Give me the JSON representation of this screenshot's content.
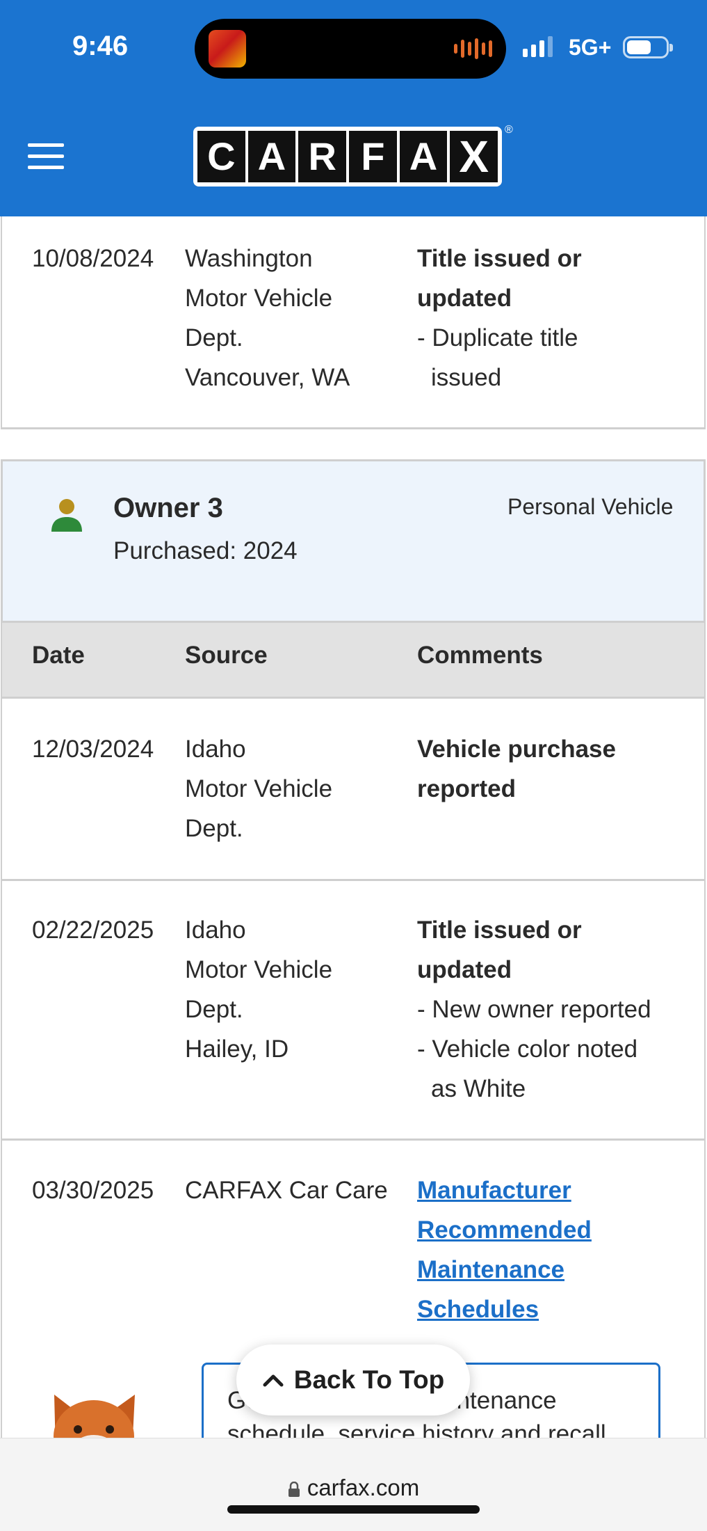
{
  "status_bar": {
    "time": "9:46",
    "network": "5G+",
    "battery_level": 0.6
  },
  "header": {
    "logo_letters": [
      "C",
      "A",
      "R",
      "F",
      "A",
      "X"
    ],
    "logo_registered": "®",
    "brand_color": "#1b74d0"
  },
  "previous_record": {
    "date": "10/08/2024",
    "source_lines": [
      "Washington",
      "Motor Vehicle",
      "Dept.",
      "Vancouver, WA"
    ],
    "comment_title": "Title issued or updated",
    "comment_items": [
      "- Duplicate title issued"
    ]
  },
  "owner": {
    "title": "Owner 3",
    "purchased": "Purchased: 2024",
    "type": "Personal Vehicle"
  },
  "table": {
    "headers": [
      "Date",
      "Source",
      "Comments"
    ],
    "rows": [
      {
        "date": "12/03/2024",
        "source_lines": [
          "Idaho",
          "Motor Vehicle",
          "Dept."
        ],
        "comment_title": "Vehicle purchase reported"
      },
      {
        "date": "02/22/2025",
        "source_lines": [
          "Idaho",
          "Motor Vehicle",
          "Dept.",
          "Hailey, ID"
        ],
        "comment_title": "Title issued or updated",
        "comment_items": [
          "- New owner reported",
          "- Vehicle color noted as White"
        ]
      },
      {
        "date": "03/30/2025",
        "source": "CARFAX Car Care",
        "comment_link": "Manufacturer Recommended Maintenance Schedules"
      }
    ]
  },
  "promo": {
    "text": "Get this vehicle's maintenance schedule, service history and recall"
  },
  "back_to_top": {
    "label": "Back To Top"
  },
  "browser": {
    "url": "carfax.com"
  },
  "colors": {
    "link": "#1b6fc8",
    "owner_bg": "#edf4fc",
    "table_header_bg": "#e2e2e2",
    "owner_icon_head": "#b8901e",
    "owner_icon_body": "#2e8a3a"
  }
}
